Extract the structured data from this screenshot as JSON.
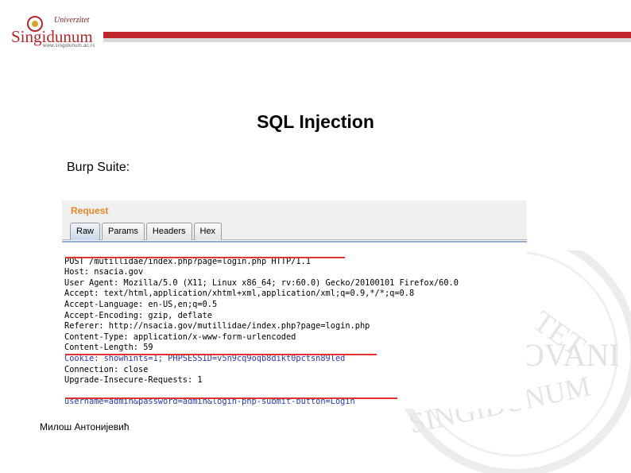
{
  "logo": {
    "line1": "Univerzitet",
    "line2": "Singidunum",
    "line3": "www.singidunum.ac.rs"
  },
  "watermark": {
    "text1": "TET",
    "text2": "OVANI",
    "text3": "SINGIDUNUM"
  },
  "slide": {
    "title": "SQL Injection",
    "subtitle": "Burp Suite:"
  },
  "burp": {
    "section_label": "Request",
    "tabs": [
      {
        "label": "Raw",
        "active": true
      },
      {
        "label": "Params",
        "active": false
      },
      {
        "label": "Headers",
        "active": false
      },
      {
        "label": "Hex",
        "active": false
      }
    ],
    "lines": [
      "POST /mutillidae/index.php?page=login.php HTTP/1.1",
      "Host: nsacia.gov",
      "User Agent: Mozilla/5.0 (X11; Linux x86_64; rv:60.0) Gecko/20100101 Firefox/60.0",
      "Accept: text/html,application/xhtml+xml,application/xml;q=0.9,*/*;q=0.8",
      "Accept-Language: en-US,en;q=0.5",
      "Accept-Encoding: gzip, deflate",
      "Referer: http://nsacia.gov/mutillidae/index.php?page=login.php",
      "Content-Type: application/x-www-form-urlencoded",
      "Content-Length: 59",
      "Cookie: showhints=1; PHPSESSID=v5n9cq9oqb8dikt0pctsn89led",
      "Connection: close",
      "Upgrade-Insecure-Requests: 1",
      "",
      "username=admin&password=admin&login-php-submit-button=Login"
    ]
  },
  "footer": {
    "author": "Милош Антонијевић"
  },
  "colors": {
    "brand_red": "#c0272d",
    "burp_orange": "#e58925",
    "highlight_red": "#e0322f"
  }
}
